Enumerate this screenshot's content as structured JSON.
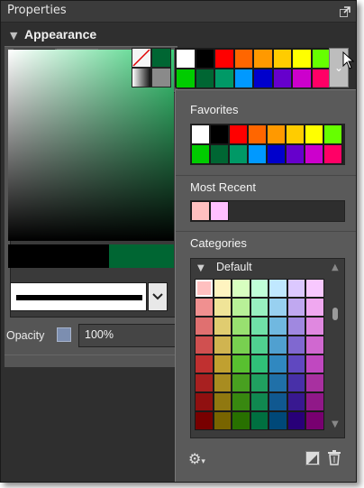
{
  "panel": {
    "title": "Properties"
  },
  "appearance": {
    "title": "Appearance",
    "opacity_label": "Opacity",
    "opacity_value": "100%",
    "current_color": "#006633",
    "previous_color": "#000000"
  },
  "top_swatches": [
    "#ffffff",
    "#000000",
    "#ff0000",
    "#ff6600",
    "#ff9900",
    "#ffcc00",
    "#ffff00",
    "#66ff00",
    "#00cc00",
    "#006633",
    "#009966",
    "#0099ff",
    "#0000cc",
    "#6600cc",
    "#cc00cc",
    "#ff0066"
  ],
  "popup": {
    "favorites_title": "Favorites",
    "favorites": [
      "#ffffff",
      "#000000",
      "#ff0000",
      "#ff6600",
      "#ff9900",
      "#ffcc00",
      "#ffff00",
      "#66ff00",
      "#00cc00",
      "#006633",
      "#009966",
      "#0099ff",
      "#0000cc",
      "#6600cc",
      "#cc00cc",
      "#ff0066"
    ],
    "recent_title": "Most Recent",
    "recent": [
      "#ffc0c0",
      "#ffc0ff"
    ],
    "categories_title": "Categories",
    "category_name": "Default",
    "category_colors": [
      "#ffc0c0",
      "#fff4c0",
      "#d8ffc0",
      "#c0ffd8",
      "#c0e8ff",
      "#dcc8ff",
      "#f8c8ff",
      "#f09090",
      "#f0e498",
      "#b8f098",
      "#98f0c0",
      "#98d0f0",
      "#c0a8f0",
      "#f0a8f0",
      "#e07070",
      "#e0cc70",
      "#98e070",
      "#70e0a8",
      "#70b8e0",
      "#a088e0",
      "#e088e0",
      "#d05050",
      "#d0b450",
      "#78d050",
      "#50d090",
      "#50a0d0",
      "#8068d0",
      "#d068d0",
      "#c03030",
      "#c0a030",
      "#58c030",
      "#30c078",
      "#3088c0",
      "#6048c0",
      "#c048c0",
      "#a82020",
      "#a88c20",
      "#48a020",
      "#20a060",
      "#2070a8",
      "#4830a8",
      "#a830a0",
      "#901010",
      "#907810",
      "#388810",
      "#108850",
      "#105890",
      "#381890",
      "#901888",
      "#780000",
      "#786400",
      "#287000",
      "#007040",
      "#004878",
      "#280078",
      "#780070"
    ]
  }
}
